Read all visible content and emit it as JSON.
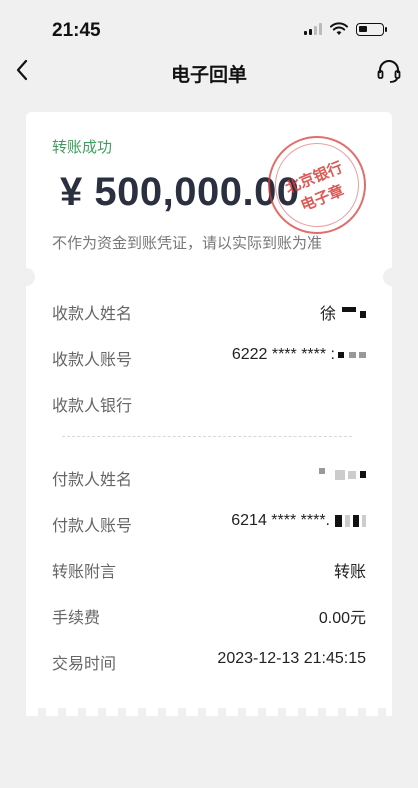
{
  "status_bar": {
    "time": "21:45"
  },
  "nav": {
    "title": "电子回单"
  },
  "receipt": {
    "status": "转账成功",
    "amount": "¥ 500,000.00",
    "disclaimer": "不作为资金到账凭证，请以实际到账为准",
    "stamp": {
      "line1": "北京银行",
      "line2": "电子章"
    }
  },
  "payee": {
    "name_label": "收款人姓名",
    "name_value": "徐",
    "account_label": "收款人账号",
    "account_value": "6222 **** **** :",
    "bank_label": "收款人银行",
    "bank_value": ""
  },
  "payer": {
    "name_label": "付款人姓名",
    "name_value": "",
    "account_label": "付款人账号",
    "account_value": "6214 **** ****."
  },
  "details": {
    "remark_label": "转账附言",
    "remark_value": "转账",
    "fee_label": "手续费",
    "fee_value": "0.00元",
    "time_label": "交易时间",
    "time_value": "2023-12-13 21:45:15"
  },
  "colors": {
    "success": "#3e9e60",
    "amount": "#2b3040",
    "stamp": "#d63e3a",
    "background": "#f0f0f0"
  },
  "icons": {
    "back": "chevron-left-icon",
    "service": "headset-icon",
    "signal": "signal-icon",
    "wifi": "wifi-icon",
    "battery": "battery-icon"
  }
}
